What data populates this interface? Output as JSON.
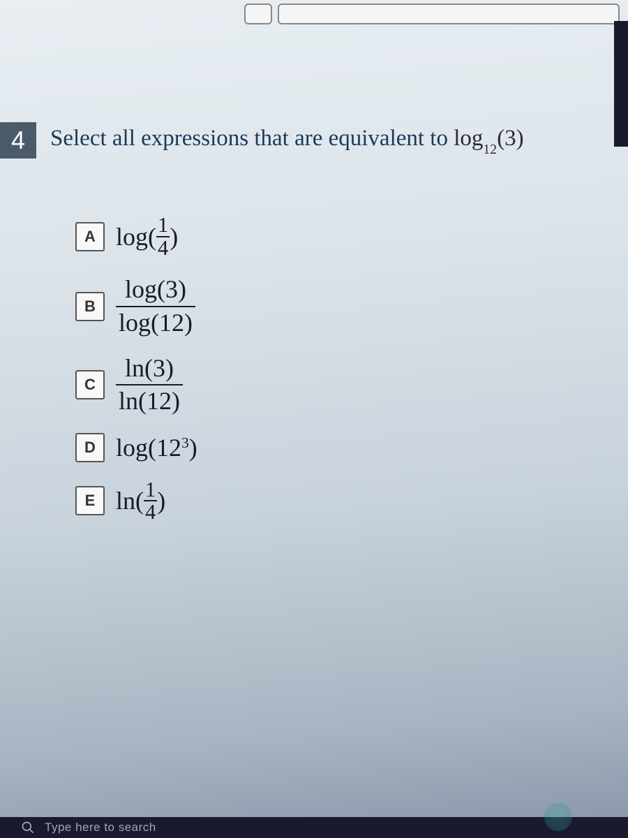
{
  "question": {
    "number": "4",
    "prompt_pre": "Select all expressions that are equivalent to ",
    "target_fn": "log",
    "target_sub": "12",
    "target_arg": "(3)"
  },
  "options": [
    {
      "letter": "A"
    },
    {
      "letter": "B"
    },
    {
      "letter": "C"
    },
    {
      "letter": "D"
    },
    {
      "letter": "E"
    }
  ],
  "optA": {
    "fn": "log(",
    "num": "1",
    "den": "4",
    "close": ")"
  },
  "optB": {
    "num": "log(3)",
    "den": "log(12)"
  },
  "optC": {
    "num": "ln(3)",
    "den": "ln(12)"
  },
  "optD": {
    "fn": "log(12",
    "sup": "3",
    "close": ")"
  },
  "optE": {
    "fn": "ln(",
    "num": "1",
    "den": "4",
    "close": ")"
  },
  "taskbar": {
    "search_placeholder": "Type here to search"
  }
}
